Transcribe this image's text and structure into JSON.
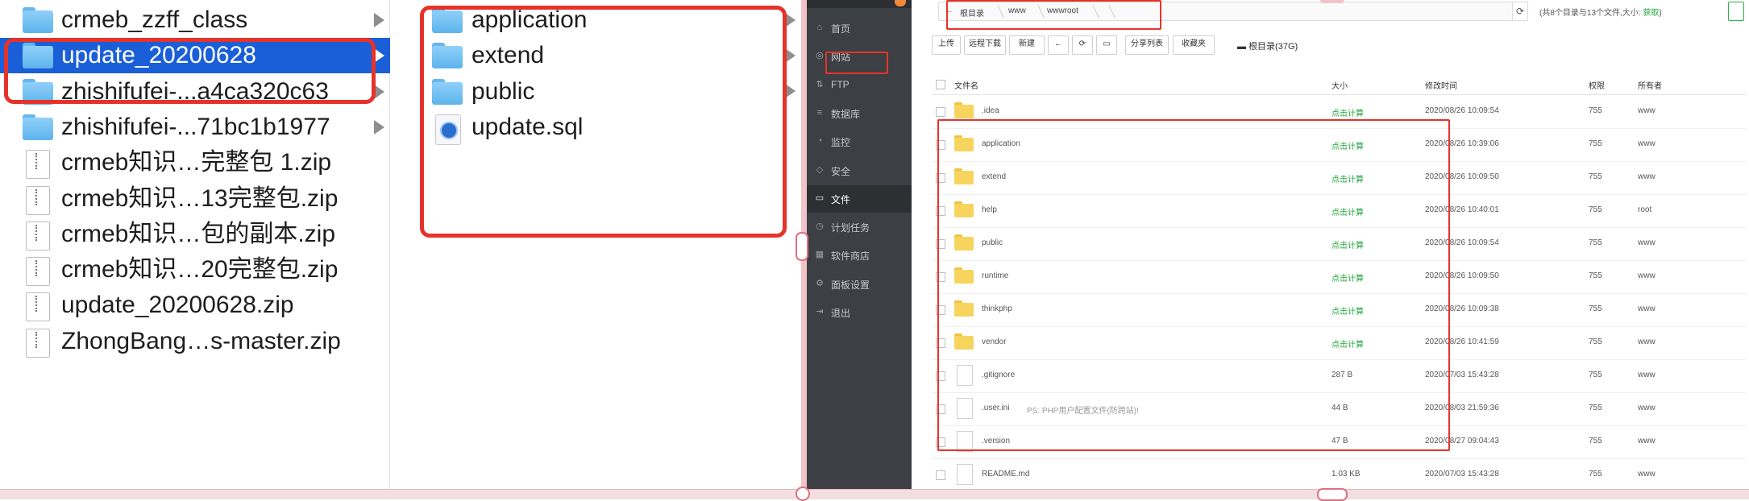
{
  "finder": {
    "column1": [
      {
        "name": "crmeb_zzff_class",
        "type": "folder",
        "selected": false,
        "has_children": true
      },
      {
        "name": "update_20200628",
        "type": "folder",
        "selected": true,
        "has_children": true
      },
      {
        "name": "zhishifufei-...a4ca320c63",
        "type": "folder",
        "selected": false,
        "has_children": true
      },
      {
        "name": "zhishifufei-...71bc1b1977",
        "type": "folder",
        "selected": false,
        "has_children": true
      },
      {
        "name": "crmeb知识…完整包 1.zip",
        "type": "zip",
        "selected": false,
        "has_children": false
      },
      {
        "name": "crmeb知识…13完整包.zip",
        "type": "zip",
        "selected": false,
        "has_children": false
      },
      {
        "name": "crmeb知识…包的副本.zip",
        "type": "zip",
        "selected": false,
        "has_children": false
      },
      {
        "name": "crmeb知识…20完整包.zip",
        "type": "zip",
        "selected": false,
        "has_children": false
      },
      {
        "name": "update_20200628.zip",
        "type": "zip",
        "selected": false,
        "has_children": false
      },
      {
        "name": "ZhongBang…s-master.zip",
        "type": "zip",
        "selected": false,
        "has_children": false
      }
    ],
    "column2": [
      {
        "name": "application",
        "type": "folder"
      },
      {
        "name": "extend",
        "type": "folder"
      },
      {
        "name": "public",
        "type": "folder"
      },
      {
        "name": "update.sql",
        "type": "sql"
      }
    ]
  },
  "panel": {
    "sidebar": [
      {
        "label": "首页",
        "icon": "home-icon",
        "active": false
      },
      {
        "label": "网站",
        "icon": "globe-icon",
        "active": false
      },
      {
        "label": "FTP",
        "icon": "ftp-icon",
        "active": false
      },
      {
        "label": "数据库",
        "icon": "database-icon",
        "active": false
      },
      {
        "label": "监控",
        "icon": "monitor-icon",
        "active": false
      },
      {
        "label": "安全",
        "icon": "shield-icon",
        "active": false
      },
      {
        "label": "文件",
        "icon": "folder-icon",
        "active": true
      },
      {
        "label": "计划任务",
        "icon": "clock-icon",
        "active": false
      },
      {
        "label": "软件商店",
        "icon": "store-icon",
        "active": false
      },
      {
        "label": "面板设置",
        "icon": "gear-icon",
        "active": false
      },
      {
        "label": "退出",
        "icon": "logout-icon",
        "active": false
      }
    ],
    "path": [
      "根目录",
      "www",
      "wwwroot"
    ],
    "summary": "(共8个目录与13个文件,大小:",
    "summary_link": "获取",
    "summary_end": ")",
    "toolbar": [
      "上传",
      "远程下载",
      "新建",
      "←",
      "⟳",
      "▭",
      "分享列表",
      "收藏夹"
    ],
    "disk_label": "根目录(37G)",
    "columns": {
      "name": "文件名",
      "size": "大小",
      "mtime": "修改时间",
      "perm": "权限",
      "owner": "所有者"
    },
    "files": [
      {
        "name": ".idea",
        "type": "folder",
        "size": "点击计算",
        "mtime": "2020/08/26 10:09:54",
        "perm": "755",
        "owner": "www"
      },
      {
        "name": "application",
        "type": "folder",
        "size": "点击计算",
        "mtime": "2020/08/26 10:39:06",
        "perm": "755",
        "owner": "www"
      },
      {
        "name": "extend",
        "type": "folder",
        "size": "点击计算",
        "mtime": "2020/08/26 10:09:50",
        "perm": "755",
        "owner": "www"
      },
      {
        "name": "help",
        "type": "folder",
        "size": "点击计算",
        "mtime": "2020/08/26 10:40:01",
        "perm": "755",
        "owner": "root"
      },
      {
        "name": "public",
        "type": "folder",
        "size": "点击计算",
        "mtime": "2020/08/26 10:09:54",
        "perm": "755",
        "owner": "www"
      },
      {
        "name": "runtime",
        "type": "folder",
        "size": "点击计算",
        "mtime": "2020/08/26 10:09:50",
        "perm": "755",
        "owner": "www"
      },
      {
        "name": "thinkphp",
        "type": "folder",
        "size": "点击计算",
        "mtime": "2020/08/26 10:09:38",
        "perm": "755",
        "owner": "www"
      },
      {
        "name": "vendor",
        "type": "folder",
        "size": "点击计算",
        "mtime": "2020/08/26 10:41:59",
        "perm": "755",
        "owner": "www"
      },
      {
        "name": ".gitignore",
        "type": "file",
        "size": "287 B",
        "mtime": "2020/07/03 15:43:28",
        "perm": "755",
        "owner": "www"
      },
      {
        "name": ".user.ini",
        "type": "file",
        "note": "PS: PHP用户配置文件(防跨站)!",
        "size": "44 B",
        "mtime": "2020/08/03 21:59:36",
        "perm": "755",
        "owner": "www"
      },
      {
        "name": ".version",
        "type": "file",
        "size": "47 B",
        "mtime": "2020/08/27 09:04:43",
        "perm": "755",
        "owner": "www"
      },
      {
        "name": "README.md",
        "type": "file",
        "size": "1.03 KB",
        "mtime": "2020/07/03 15:43:28",
        "perm": "755",
        "owner": "www"
      }
    ]
  },
  "colors": {
    "annotation": "#e5332a",
    "selection": "#1a5fd7",
    "green": "#20a53a",
    "sidebar": "#3c3f43"
  }
}
